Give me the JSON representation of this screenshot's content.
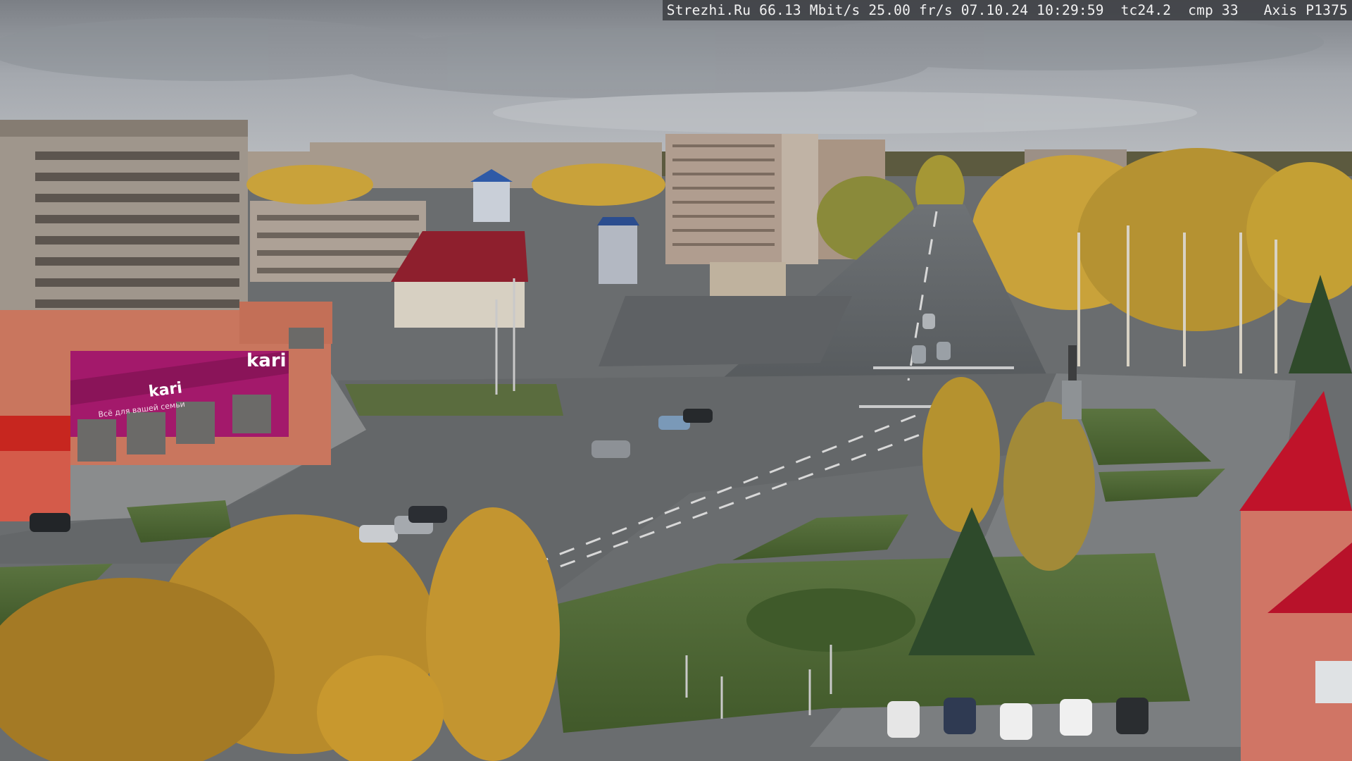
{
  "camera_overlay": {
    "site": "Strezhi.Ru",
    "bitrate": "66.13 Mbit/s",
    "framerate": "25.00 fr/s",
    "datetime": "07.10.24 10:29:59",
    "tc": "tc24.2",
    "compression": "cmp 33",
    "camera_model": "Axis P1375"
  },
  "store_signs": {
    "kari_logo": "kari",
    "kari_wall": "kari",
    "kari_tagline": "Всё для вашей семьи"
  },
  "colors": {
    "sky": "#a9adb3",
    "road": "#5f6366",
    "grass": "#4f6a34",
    "autumn_foliage": "#c9a23a",
    "kari_magenta": "#a3196b",
    "red_roof": "#b8142a"
  }
}
